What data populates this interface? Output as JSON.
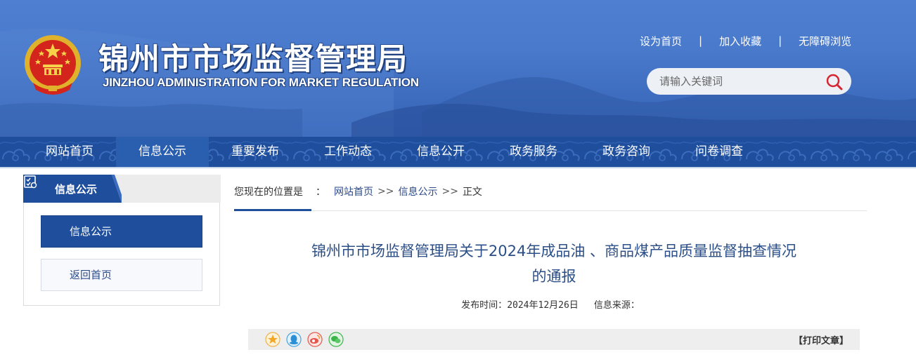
{
  "header": {
    "title": "锦州市市场监督管理局",
    "subtitle": "JINZHOU ADMINISTRATION FOR MARKET REGULATION",
    "emblem_icon": "national-emblem-icon",
    "top_links": {
      "set_home": "设为首页",
      "add_favorite": "加入收藏",
      "accessible": "无障碍浏览",
      "separator": "|"
    },
    "search": {
      "placeholder": "请输入关键词",
      "icon": "search-icon"
    },
    "colors": {
      "banner": "#4a7acb",
      "nav": "#1f4f9c"
    }
  },
  "nav": {
    "items": [
      "网站首页",
      "信息公示",
      "重要发布",
      "工作动态",
      "信息公开",
      "政务服务",
      "政务咨询",
      "问卷调查"
    ],
    "active": "信息公示"
  },
  "sidebar": {
    "heading": "信息公示",
    "heading_icon": "checklist-icon",
    "items": [
      "信息公示",
      "返回首页"
    ]
  },
  "breadcrumb": {
    "label": "您现在的位置是",
    "colon": "：",
    "items": [
      "网站首页",
      "信息公示",
      "正文"
    ],
    "separator": ">>"
  },
  "article": {
    "title_line1": "锦州市市场监督管理局关于2024年成品油 、商品煤产品质量监督抽查情况",
    "title_line2": "的通报",
    "publish_label": "发布时间：",
    "publish_date": "2024年12月26日",
    "source_label": "信息来源："
  },
  "share": {
    "icons": [
      "qzone-icon",
      "qq-icon",
      "weibo-icon",
      "wechat-icon"
    ],
    "print": "【打印文章】"
  }
}
